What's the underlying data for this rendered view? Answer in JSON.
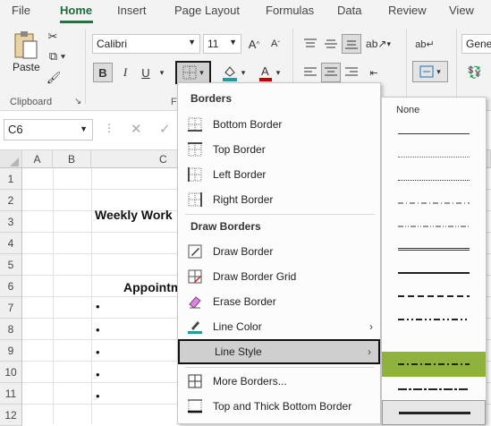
{
  "tabs": [
    "File",
    "Home",
    "Insert",
    "Page Layout",
    "Formulas",
    "Data",
    "Review",
    "View"
  ],
  "ribbon": {
    "paste_label": "Paste",
    "clipboard_group": "Clipboard",
    "font_name": "Calibri",
    "font_size": "11",
    "font_group_initial": "F",
    "bold": "B",
    "italic": "I",
    "underline": "U",
    "number_format": "Gene"
  },
  "formula_bar": {
    "name_box": "C6"
  },
  "columns": [
    "A",
    "B",
    "C"
  ],
  "rows": [
    "1",
    "2",
    "3",
    "4",
    "5",
    "6",
    "7",
    "8",
    "9",
    "10",
    "11",
    "12"
  ],
  "cells": {
    "c3": "Weekly Work",
    "c7": "Appointm",
    "bullet": "•"
  },
  "borders_menu": {
    "heading_borders": "Borders",
    "bottom_border": "Bottom Border",
    "top_border": "Top Border",
    "left_border": "Left Border",
    "right_border": "Right Border",
    "heading_draw": "Draw Borders",
    "draw_border": "Draw Border",
    "draw_border_grid": "Draw Border Grid",
    "erase_border": "Erase Border",
    "line_color": "Line Color",
    "line_style": "Line Style",
    "more_borders": "More Borders...",
    "top_thick_bottom": "Top and Thick Bottom Border"
  },
  "line_style_menu": {
    "none_label": "None",
    "styles": [
      "thin",
      "dotted-fine",
      "dotted",
      "dash-dot",
      "dash-dot-dot",
      "double",
      "medium",
      "medium-dashed",
      "medium-dash-dot-dot",
      "medium-dash-dot",
      "slant-dash-dot",
      "thick"
    ],
    "highlighted_style": "medium-dash-dot",
    "highlight_color": "#8fb23e"
  },
  "colors": {
    "accent": "#217346",
    "line_color_swatch": "#1f9e9e",
    "font_color_swatch": "#c00000"
  }
}
